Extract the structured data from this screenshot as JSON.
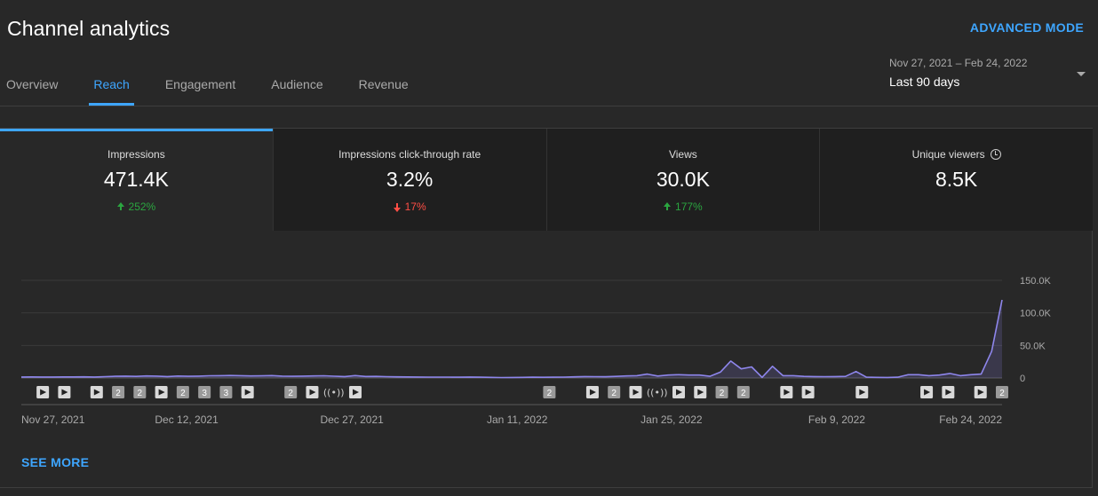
{
  "header": {
    "title": "Channel analytics",
    "advanced_mode": "ADVANCED MODE"
  },
  "tabs": [
    {
      "label": "Overview"
    },
    {
      "label": "Reach"
    },
    {
      "label": "Engagement"
    },
    {
      "label": "Audience"
    },
    {
      "label": "Revenue"
    }
  ],
  "date_range": {
    "range": "Nov 27, 2021 – Feb 24, 2022",
    "label": "Last 90 days"
  },
  "metrics": [
    {
      "label": "Impressions",
      "value": "471.4K",
      "change": "252%",
      "direction": "up"
    },
    {
      "label": "Impressions click-through rate",
      "value": "3.2%",
      "change": "17%",
      "direction": "down"
    },
    {
      "label": "Views",
      "value": "30.0K",
      "change": "177%",
      "direction": "up"
    },
    {
      "label": "Unique viewers",
      "value": "8.5K",
      "icon": "clock-icon"
    }
  ],
  "see_more": "SEE MORE",
  "colors": {
    "accent": "#3ea6ff",
    "line": "#8e86ec",
    "up": "#2ba640",
    "down": "#ff4e45"
  },
  "chart_data": {
    "type": "line",
    "x": [
      "Nov 27, 2021",
      "Dec 12, 2021",
      "Dec 27, 2021",
      "Jan 11, 2022",
      "Jan 25, 2022",
      "Feb 9, 2022",
      "Feb 24, 2022"
    ],
    "x_tick_days": [
      0,
      15,
      30,
      45,
      59,
      74,
      89
    ],
    "ylim": [
      0,
      150000
    ],
    "y_ticks": [
      "0",
      "50.0K",
      "100.0K",
      "150.0K"
    ],
    "y_tick_values": [
      0,
      50000,
      100000,
      150000
    ],
    "series": [
      {
        "values": [
          1500,
          1600,
          1500,
          1500,
          1600,
          1700,
          1800,
          1500,
          2000,
          2600,
          2900,
          2500,
          3100,
          2800,
          2200,
          3000,
          2600,
          2800,
          3400,
          3600,
          3800,
          3500,
          3200,
          3300,
          3700,
          2800,
          2600,
          2800,
          3100,
          3400,
          2700,
          2200,
          3700,
          2300,
          2500,
          2000,
          1800,
          1700,
          1500,
          1400,
          1300,
          1400,
          1200,
          1500,
          1200,
          900,
          700,
          800,
          900,
          1200,
          1100,
          1200,
          1400,
          1800,
          2200,
          2000,
          1900,
          2500,
          3200,
          3500,
          6000,
          3000,
          4500,
          5000,
          4500,
          4500,
          2600,
          9000,
          26000,
          14000,
          17000,
          1000,
          18000,
          3500,
          3500,
          2500,
          2200,
          2000,
          2200,
          2400,
          10000,
          1200,
          1000,
          800,
          1200,
          5000,
          5000,
          3500,
          4500,
          7000,
          3500,
          5000,
          6000,
          41000,
          120000
        ]
      }
    ],
    "markers": [
      {
        "day": 1,
        "kind": "play"
      },
      {
        "day": 3,
        "kind": "play"
      },
      {
        "day": 6,
        "kind": "play"
      },
      {
        "day": 8,
        "kind": "count",
        "text": "2"
      },
      {
        "day": 10,
        "kind": "count",
        "text": "2"
      },
      {
        "day": 12,
        "kind": "play"
      },
      {
        "day": 14,
        "kind": "count",
        "text": "2"
      },
      {
        "day": 16,
        "kind": "count",
        "text": "3"
      },
      {
        "day": 18,
        "kind": "count",
        "text": "3"
      },
      {
        "day": 20,
        "kind": "play"
      },
      {
        "day": 24,
        "kind": "count",
        "text": "2"
      },
      {
        "day": 26,
        "kind": "play"
      },
      {
        "day": 28,
        "kind": "live"
      },
      {
        "day": 30,
        "kind": "play"
      },
      {
        "day": 48,
        "kind": "count",
        "text": "2"
      },
      {
        "day": 52,
        "kind": "play"
      },
      {
        "day": 54,
        "kind": "count",
        "text": "2"
      },
      {
        "day": 56,
        "kind": "play"
      },
      {
        "day": 58,
        "kind": "live"
      },
      {
        "day": 60,
        "kind": "play"
      },
      {
        "day": 62,
        "kind": "play"
      },
      {
        "day": 64,
        "kind": "count",
        "text": "2"
      },
      {
        "day": 66,
        "kind": "count",
        "text": "2"
      },
      {
        "day": 70,
        "kind": "play"
      },
      {
        "day": 72,
        "kind": "play"
      },
      {
        "day": 77,
        "kind": "play"
      },
      {
        "day": 83,
        "kind": "play"
      },
      {
        "day": 85,
        "kind": "play"
      },
      {
        "day": 88,
        "kind": "play"
      },
      {
        "day": 90,
        "kind": "count",
        "text": "2"
      }
    ]
  }
}
